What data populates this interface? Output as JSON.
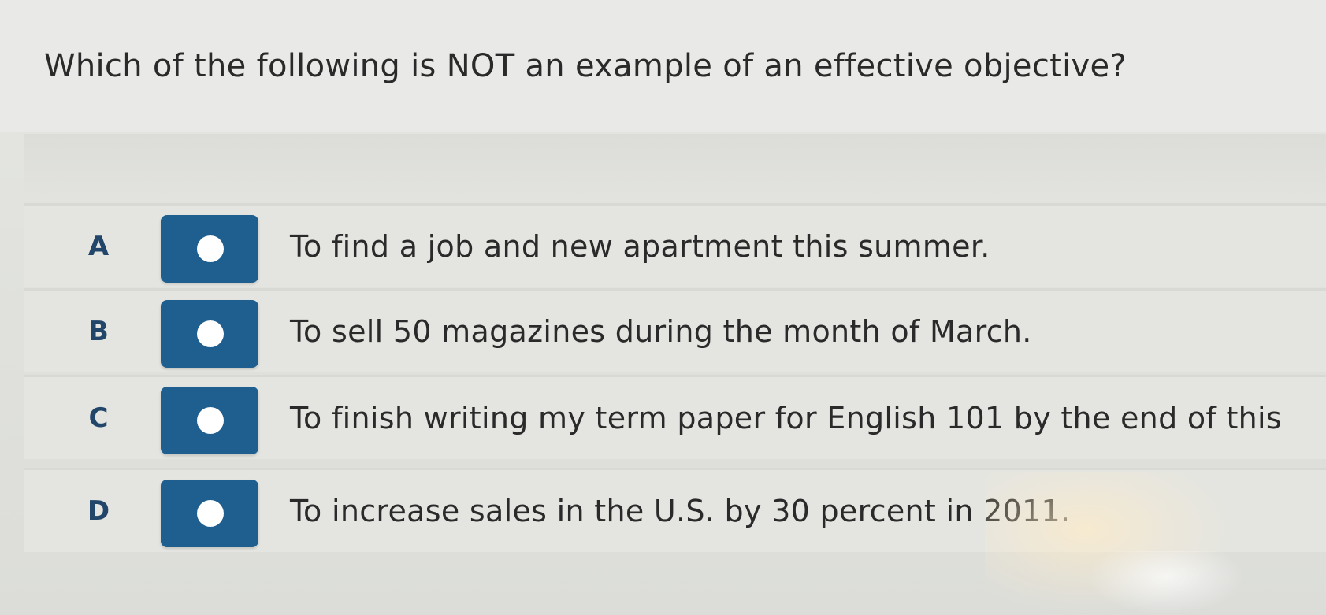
{
  "question": {
    "text": "Which of the following is NOT an example of an effective objective?"
  },
  "options": [
    {
      "letter": "A",
      "text": "To find a job and new apartment this summer."
    },
    {
      "letter": "B",
      "text": "To sell 50 magazines during the month of March."
    },
    {
      "letter": "C",
      "text": "To finish writing my term paper for English 101 by the end of this"
    },
    {
      "letter": "D",
      "text": "To increase sales in the U.S. by 30 percent in 2011."
    }
  ],
  "colors": {
    "button_fill": "#1f5f8f",
    "radio_dot": "#ffffff",
    "letter_color": "#22456a"
  }
}
